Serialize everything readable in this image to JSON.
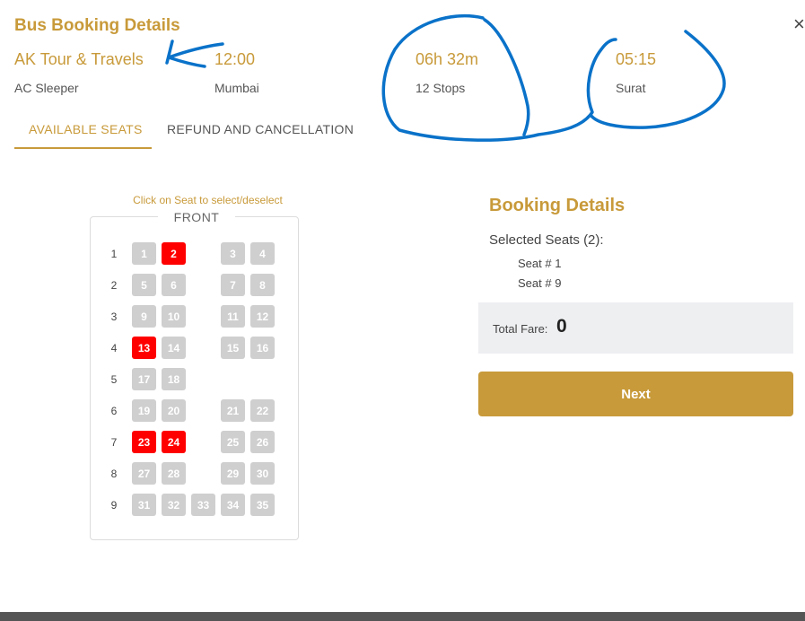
{
  "header": {
    "title": "Bus Booking Details",
    "close_glyph": "×"
  },
  "trip": {
    "operator": "AK Tour & Travels",
    "bus_type": "AC Sleeper",
    "departure_time": "12:00",
    "departure_city": "Mumbai",
    "duration": "06h 32m",
    "stops": "12 Stops",
    "arrival_time": "05:15",
    "arrival_city": "Surat"
  },
  "tabs": [
    {
      "label": "AVAILABLE SEATS",
      "active": true
    },
    {
      "label": "REFUND AND CANCELLATION",
      "active": false
    }
  ],
  "seat_map": {
    "hint": "Click on Seat to select/deselect",
    "front_label": "FRONT",
    "rows": [
      {
        "label": "1",
        "seats": [
          {
            "n": "1",
            "s": false
          },
          {
            "n": "2",
            "s": true
          },
          null,
          {
            "n": "3",
            "s": false
          },
          {
            "n": "4",
            "s": false
          }
        ]
      },
      {
        "label": "2",
        "seats": [
          {
            "n": "5",
            "s": false
          },
          {
            "n": "6",
            "s": false
          },
          null,
          {
            "n": "7",
            "s": false
          },
          {
            "n": "8",
            "s": false
          }
        ]
      },
      {
        "label": "3",
        "seats": [
          {
            "n": "9",
            "s": false
          },
          {
            "n": "10",
            "s": false
          },
          null,
          {
            "n": "11",
            "s": false
          },
          {
            "n": "12",
            "s": false
          }
        ]
      },
      {
        "label": "4",
        "seats": [
          {
            "n": "13",
            "s": true
          },
          {
            "n": "14",
            "s": false
          },
          null,
          {
            "n": "15",
            "s": false
          },
          {
            "n": "16",
            "s": false
          }
        ]
      },
      {
        "label": "5",
        "seats": [
          {
            "n": "17",
            "s": false
          },
          {
            "n": "18",
            "s": false
          },
          null,
          null,
          null
        ]
      },
      {
        "label": "6",
        "seats": [
          {
            "n": "19",
            "s": false
          },
          {
            "n": "20",
            "s": false
          },
          null,
          {
            "n": "21",
            "s": false
          },
          {
            "n": "22",
            "s": false
          }
        ]
      },
      {
        "label": "7",
        "seats": [
          {
            "n": "23",
            "s": true
          },
          {
            "n": "24",
            "s": true
          },
          null,
          {
            "n": "25",
            "s": false
          },
          {
            "n": "26",
            "s": false
          }
        ]
      },
      {
        "label": "8",
        "seats": [
          {
            "n": "27",
            "s": false
          },
          {
            "n": "28",
            "s": false
          },
          null,
          {
            "n": "29",
            "s": false
          },
          {
            "n": "30",
            "s": false
          }
        ]
      },
      {
        "label": "9",
        "seats": [
          {
            "n": "31",
            "s": false
          },
          {
            "n": "32",
            "s": false
          },
          {
            "n": "33",
            "s": false
          },
          {
            "n": "34",
            "s": false
          },
          {
            "n": "35",
            "s": false
          }
        ]
      }
    ]
  },
  "booking": {
    "title": "Booking Details",
    "selected_label": "Selected Seats (2):",
    "selected_seats": [
      "Seat # 1",
      "Seat # 9"
    ],
    "fare_label": "Total Fare:",
    "fare_value": "0",
    "next_label": "Next"
  },
  "colors": {
    "accent": "#c89a3a",
    "seat_available": "#cfcfcf",
    "seat_selected": "#ff0000",
    "annotation": "#0a72c9"
  }
}
